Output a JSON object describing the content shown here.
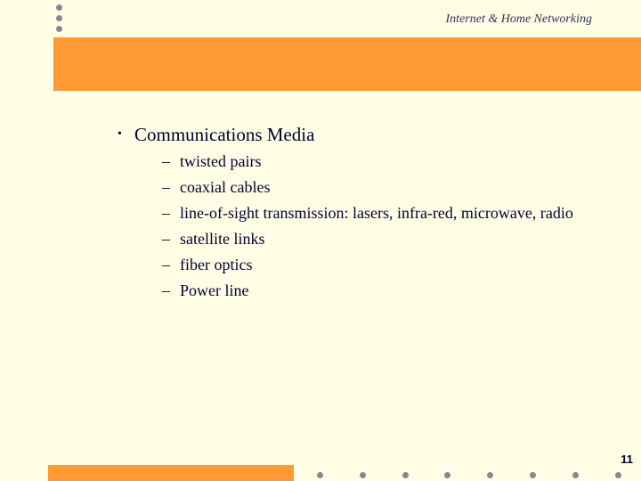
{
  "header": {
    "title": "Internet & Home Networking"
  },
  "slide": {
    "heading": "Communications Media",
    "bullet_glyph": "•",
    "dash_glyph": "–",
    "items": [
      "twisted pairs",
      "coaxial cables",
      "line-of-sight transmission: lasers, infra-red, microwave, radio",
      "satellite links",
      "fiber optics",
      "Power line"
    ]
  },
  "footer": {
    "page_number": "11"
  },
  "colors": {
    "background": "#ffffe6",
    "accent": "#ff9933",
    "text": "#000033",
    "dots": "#8a8590"
  }
}
